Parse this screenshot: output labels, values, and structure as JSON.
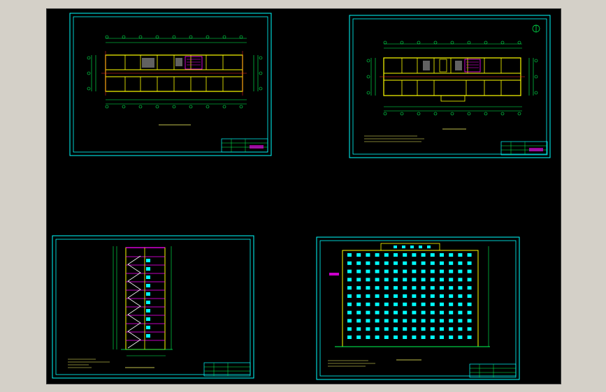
{
  "viewer": {
    "background": "#d4d0c8",
    "canvas_background": "#000000"
  },
  "colors": {
    "frame": "#00ffff",
    "wall": "#ffff00",
    "axis": "#ff2a2a",
    "dimension": "#00ff55",
    "window": "#00ffff",
    "highlight": "#ff00ff",
    "text": "#ffff66"
  },
  "sheets": [
    {
      "id": "plan-1",
      "kind": "floor-plan",
      "title_label": ""
    },
    {
      "id": "plan-2",
      "kind": "floor-plan",
      "title_label": ""
    },
    {
      "id": "section",
      "kind": "section",
      "title_label": ""
    },
    {
      "id": "elevation",
      "kind": "elevation",
      "title_label": ""
    }
  ],
  "icons": {
    "north_arrow": "north-arrow-icon"
  }
}
